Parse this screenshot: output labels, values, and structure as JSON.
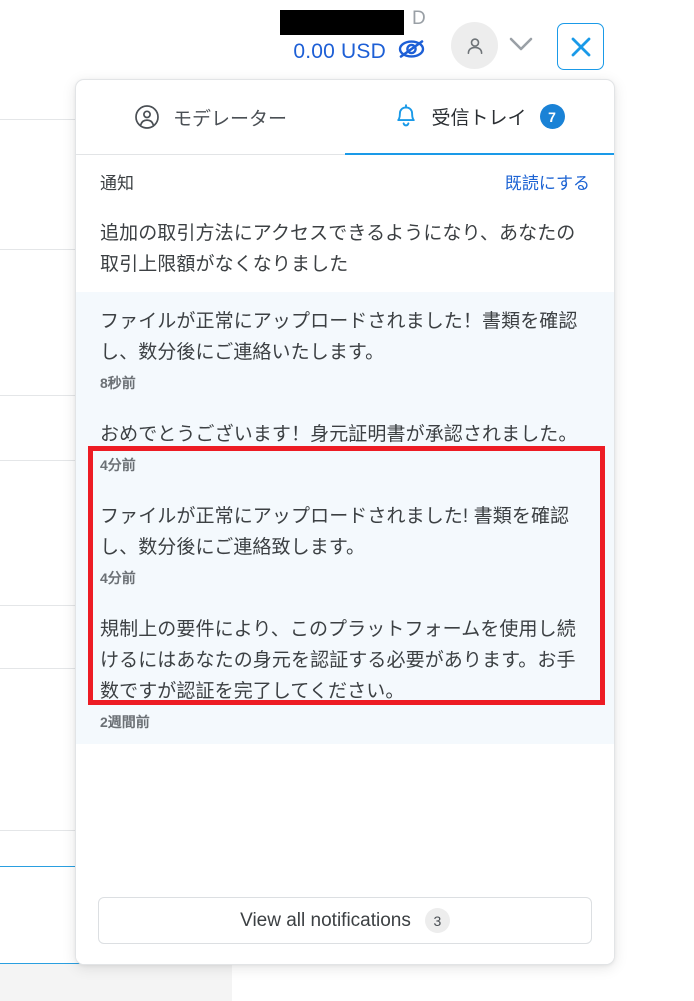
{
  "header": {
    "balance_currency_suffix": "D",
    "balance_amount": "0.00 USD",
    "hide_balance_icon": "eye-off-icon",
    "avatar_icon": "person-icon",
    "chevron_icon": "chevron-down-icon",
    "close_icon": "close-icon",
    "redacted": true
  },
  "dropdown": {
    "tabs": [
      {
        "label": "モデレーター",
        "icon": "person-circle-icon",
        "active": false,
        "badge": null
      },
      {
        "label": "受信トレイ",
        "icon": "bell-icon",
        "active": true,
        "badge": "7"
      }
    ],
    "list_header": {
      "title": "通知",
      "mark_read_label": "既読にする"
    },
    "notifications": [
      {
        "text": "追加の取引方法にアクセスできるようになり、あなたの取引上限額がなくなりました",
        "time": "",
        "unread": false
      },
      {
        "text": "ファイルが正常にアップロードされました！書類を確認し、数分後にご連絡いたします。",
        "time": "8秒前",
        "unread": true
      },
      {
        "text": "おめでとうございます！身元証明書が承認されました。",
        "time": "4分前",
        "unread": true
      },
      {
        "text": "ファイルが正常にアップロードされました! 書類を確認し、数分後にご連絡致します。",
        "time": "4分前",
        "unread": true
      },
      {
        "text": "規制上の要件により、このプラットフォームを使用し続けるにはあなたの身元を認証する必要があります。お手数ですが認証を完了してください。",
        "time": "2週間前",
        "unread": true
      }
    ],
    "footer": {
      "view_all_label": "View all notifications",
      "view_all_count": "3"
    }
  },
  "annotation": {
    "highlight_color": "#ed1c24"
  },
  "colors": {
    "accent_blue": "#1a9ae8",
    "link_blue": "#1c63d3",
    "badge_blue": "#1a82d6",
    "unread_bg": "#f4f9fd",
    "text_primary": "#3c4043",
    "text_muted": "#6b7075"
  }
}
